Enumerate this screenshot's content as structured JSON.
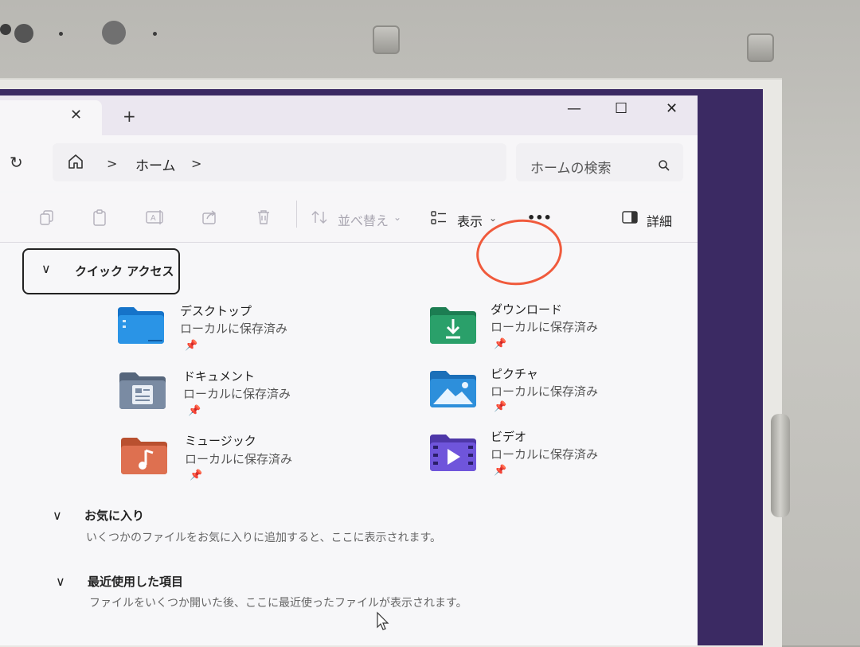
{
  "tab": {
    "close_icon": "close-icon",
    "new_icon": "plus-icon"
  },
  "window_controls": {
    "minimize": "—",
    "maximize": "☐",
    "close": "✕"
  },
  "address": {
    "refresh_icon": "refresh-icon",
    "home_icon": "home-icon",
    "separator": ">",
    "crumb": "ホーム"
  },
  "search": {
    "placeholder": "ホームの検索",
    "icon": "search-icon"
  },
  "toolbar": {
    "sort_label": "並べ替え",
    "view_label": "表示",
    "more_label": "•••",
    "details_label": "詳細"
  },
  "quick_access": {
    "title": "クイック アクセス",
    "items": [
      {
        "name": "デスクトップ",
        "sub": "ローカルに保存済み",
        "icon": "desktop-folder-icon",
        "color": "#1f7fd1"
      },
      {
        "name": "ダウンロード",
        "sub": "ローカルに保存済み",
        "icon": "download-folder-icon",
        "color": "#2a9b6a"
      },
      {
        "name": "ドキュメント",
        "sub": "ローカルに保存済み",
        "icon": "documents-folder-icon",
        "color": "#6d7f96"
      },
      {
        "name": "ピクチャ",
        "sub": "ローカルに保存済み",
        "icon": "pictures-folder-icon",
        "color": "#2a86d6"
      },
      {
        "name": "ミュージック",
        "sub": "ローカルに保存済み",
        "icon": "music-folder-icon",
        "color": "#d86a4a"
      },
      {
        "name": "ビデオ",
        "sub": "ローカルに保存済み",
        "icon": "videos-folder-icon",
        "color": "#6b4fd0"
      }
    ]
  },
  "favorites": {
    "title": "お気に入り",
    "text": "いくつかのファイルをお気に入りに追加すると、ここに表示されます。"
  },
  "recent": {
    "title": "最近使用した項目",
    "text": "ファイルをいくつか開いた後、ここに最近使ったファイルが表示されます。"
  },
  "pin_glyph": "📌"
}
